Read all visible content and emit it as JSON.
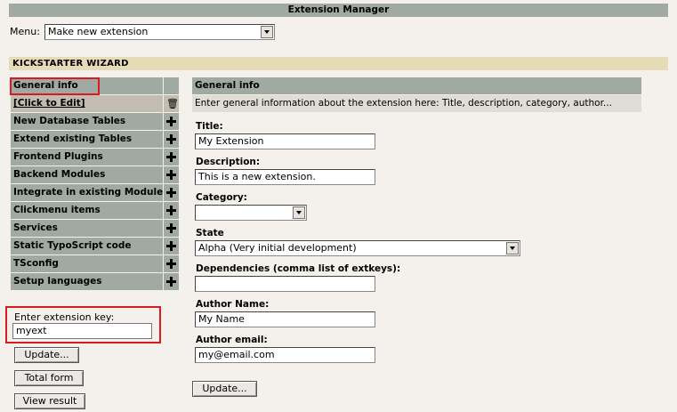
{
  "window": {
    "title": "Extension Manager"
  },
  "menu": {
    "label": "Menu:",
    "selected": "Make new extension"
  },
  "wizard": {
    "title": "KICKSTARTER WIZARD"
  },
  "sidebar": {
    "items": [
      {
        "label": "General info"
      },
      {
        "label": "[Click to Edit]"
      },
      {
        "label": "New Database Tables"
      },
      {
        "label": "Extend existing Tables"
      },
      {
        "label": "Frontend Plugins"
      },
      {
        "label": "Backend Modules"
      },
      {
        "label": "Integrate in existing Modules"
      },
      {
        "label": "Clickmenu items"
      },
      {
        "label": "Services"
      },
      {
        "label": "Static TypoScript code"
      },
      {
        "label": "TSconfig"
      },
      {
        "label": "Setup languages"
      }
    ]
  },
  "extkey": {
    "label": "Enter extension key:",
    "value": "myext"
  },
  "buttons": {
    "update": "Update...",
    "total_form": "Total form",
    "view_result": "View result",
    "main_update": "Update..."
  },
  "main": {
    "header": "General info",
    "description": "Enter general information about the extension here: Title, description, category, author...",
    "title_label": "Title:",
    "title_value": "My Extension",
    "desc_label": "Description:",
    "desc_value": "This is a new extension.",
    "category_label": "Category:",
    "category_value": "",
    "state_label": "State",
    "state_value": "Alpha (Very initial development)",
    "deps_label": "Dependencies (comma list of extkeys):",
    "deps_value": "",
    "author_name_label": "Author Name:",
    "author_name_value": "My Name",
    "author_email_label": "Author email:",
    "author_email_value": "my@email.com"
  },
  "colors": {
    "header_bar": "#a0aaa3",
    "wizard_bar": "#e5dcb7",
    "highlight": "#d81b22",
    "background": "#f4f1ec"
  }
}
